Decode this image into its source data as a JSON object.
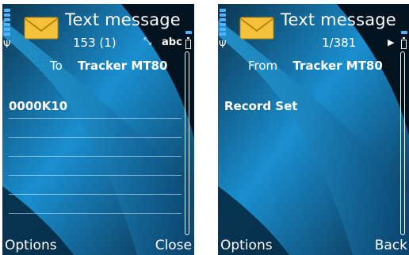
{
  "left": {
    "title": "Text message",
    "counter": "153 (1)",
    "input_mode": "abc",
    "header_label": "To",
    "header_value": "Tracker MT80",
    "body": "0000K10",
    "softkey_left": "Options",
    "softkey_right": "Close"
  },
  "right": {
    "title": "Text message",
    "counter": "1/381",
    "header_label": "From",
    "header_value": "Tracker MT80",
    "body": "Record Set",
    "softkey_left": "Options",
    "softkey_right": "Back"
  },
  "colors": {
    "accent": "#4fb4ff",
    "background_dark": "#0a1a2a",
    "background_light": "#1aa0e0"
  },
  "icons": [
    "envelope-icon",
    "signal-strength-icon",
    "battery-level-icon",
    "antenna-icon",
    "battery-icon",
    "text-input-icon",
    "navigation-arrow-icon"
  ]
}
